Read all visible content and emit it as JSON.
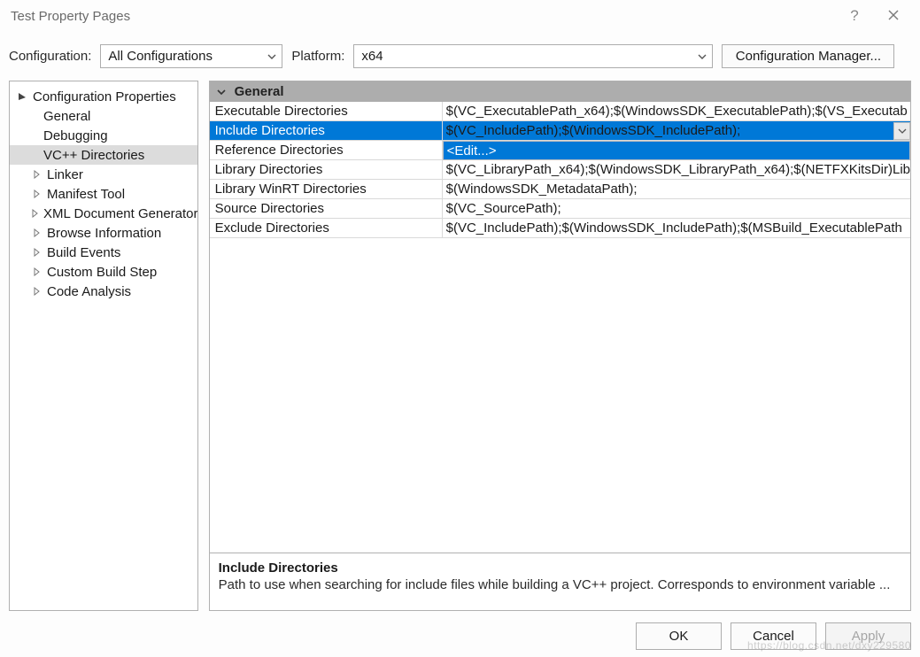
{
  "window": {
    "title": "Test Property Pages"
  },
  "toolbar": {
    "config_label": "Configuration:",
    "config_value": "All Configurations",
    "platform_label": "Platform:",
    "platform_value": "x64",
    "cfgmgr_label": "Configuration Manager..."
  },
  "tree": {
    "root": "Configuration Properties",
    "items": [
      {
        "label": "General",
        "expandable": false
      },
      {
        "label": "Debugging",
        "expandable": false
      },
      {
        "label": "VC++ Directories",
        "expandable": false,
        "selected": true
      },
      {
        "label": "Linker",
        "expandable": true
      },
      {
        "label": "Manifest Tool",
        "expandable": true
      },
      {
        "label": "XML Document Generator",
        "expandable": true
      },
      {
        "label": "Browse Information",
        "expandable": true
      },
      {
        "label": "Build Events",
        "expandable": true
      },
      {
        "label": "Custom Build Step",
        "expandable": true
      },
      {
        "label": "Code Analysis",
        "expandable": true
      }
    ]
  },
  "grid": {
    "section": "General",
    "rows": [
      {
        "name": "Executable Directories",
        "value": "$(VC_ExecutablePath_x64);$(WindowsSDK_ExecutablePath);$(VS_Executab"
      },
      {
        "name": "Include Directories",
        "value": "$(VC_IncludePath);$(WindowsSDK_IncludePath);",
        "selected": true
      },
      {
        "name": "Reference Directories",
        "value": "<Edit...>",
        "in_dropdown": true
      },
      {
        "name": "Library Directories",
        "value": "$(VC_LibraryPath_x64);$(WindowsSDK_LibraryPath_x64);$(NETFXKitsDir)Lib"
      },
      {
        "name": "Library WinRT Directories",
        "value": "$(WindowsSDK_MetadataPath);"
      },
      {
        "name": "Source Directories",
        "value": "$(VC_SourcePath);"
      },
      {
        "name": "Exclude Directories",
        "value": "$(VC_IncludePath);$(WindowsSDK_IncludePath);$(MSBuild_ExecutablePath"
      }
    ]
  },
  "description": {
    "title": "Include Directories",
    "body": "Path to use when searching for include files while building a VC++ project.  Corresponds to environment variable ..."
  },
  "buttons": {
    "ok": "OK",
    "cancel": "Cancel",
    "apply": "Apply"
  },
  "watermark": "https://blog.csdn.net/dxy229580"
}
